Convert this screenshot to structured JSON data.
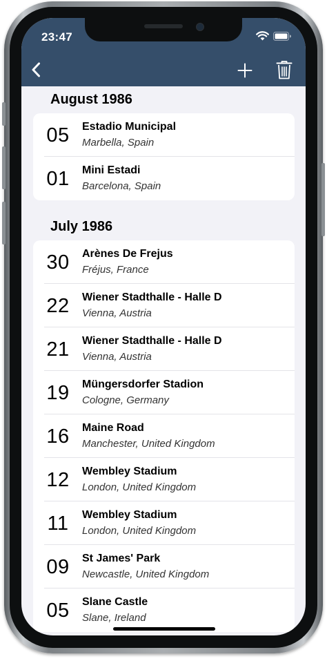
{
  "status_bar": {
    "time": "23:47"
  },
  "nav": {
    "back_icon": "chevron-left-icon",
    "add_icon": "plus-icon",
    "delete_icon": "trash-icon"
  },
  "sections": [
    {
      "title": "August 1986",
      "rows": [
        {
          "day": "05",
          "venue": "Estadio Municipal",
          "place": "Marbella, Spain"
        },
        {
          "day": "01",
          "venue": "Mini Estadi",
          "place": "Barcelona, Spain"
        }
      ]
    },
    {
      "title": "July 1986",
      "rows": [
        {
          "day": "30",
          "venue": "Arènes De Frejus",
          "place": "Fréjus, France"
        },
        {
          "day": "22",
          "venue": "Wiener Stadthalle - Halle D",
          "place": "Vienna, Austria"
        },
        {
          "day": "21",
          "venue": "Wiener Stadthalle - Halle D",
          "place": "Vienna, Austria"
        },
        {
          "day": "19",
          "venue": "Müngersdorfer Stadion",
          "place": "Cologne, Germany"
        },
        {
          "day": "16",
          "venue": "Maine Road",
          "place": "Manchester, United Kingdom"
        },
        {
          "day": "12",
          "venue": "Wembley Stadium",
          "place": "London, United Kingdom"
        },
        {
          "day": "11",
          "venue": "Wembley Stadium",
          "place": "London, United Kingdom"
        },
        {
          "day": "09",
          "venue": "St James' Park",
          "place": "Newcastle, United Kingdom"
        },
        {
          "day": "05",
          "venue": "Slane Castle",
          "place": "Slane, Ireland"
        }
      ]
    }
  ],
  "colors": {
    "nav_bar": "#354e6a",
    "background": "#f2f2f7",
    "card": "#ffffff"
  }
}
